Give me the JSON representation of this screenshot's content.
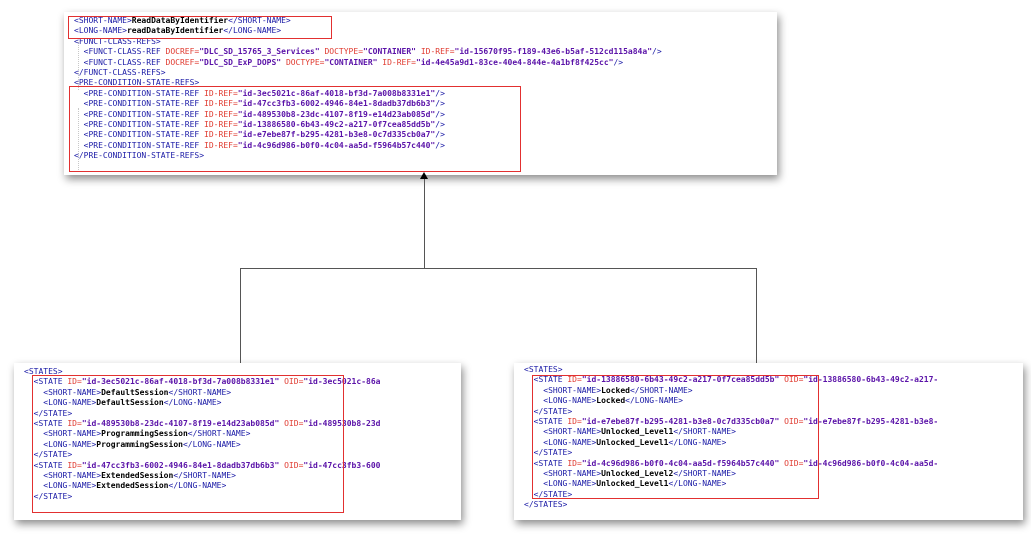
{
  "top_panel": {
    "lines": [
      [
        [
          "tag",
          "<SHORT-NAME>"
        ],
        [
          "txt",
          "ReadDataByIdentifier"
        ],
        [
          "tag",
          "</SHORT-NAME>"
        ]
      ],
      [
        [
          "tag",
          "<LONG-NAME>"
        ],
        [
          "txt",
          "readDataByIdentifier"
        ],
        [
          "tag",
          "</LONG-NAME>"
        ]
      ],
      [
        [
          "tag",
          "<FUNCT-CLASS-REFS>"
        ]
      ],
      [
        [
          "tag",
          "  <FUNCT-CLASS-REF "
        ],
        [
          "attr",
          "DOCREF="
        ],
        [
          "val",
          "\"DLC_SD_15765_3_Services\""
        ],
        [
          "attr",
          " DOCTYPE="
        ],
        [
          "val",
          "\"CONTAINER\""
        ],
        [
          "attr",
          " ID-REF="
        ],
        [
          "val",
          "\"id-15670f95-f189-43e6-b5af-512cd115a84a\""
        ],
        [
          "tag",
          "/>"
        ]
      ],
      [
        [
          "tag",
          "  <FUNCT-CLASS-REF "
        ],
        [
          "attr",
          "DOCREF="
        ],
        [
          "val",
          "\"DLC_SD_ExP_DOPS\""
        ],
        [
          "attr",
          " DOCTYPE="
        ],
        [
          "val",
          "\"CONTAINER\""
        ],
        [
          "attr",
          " ID-REF="
        ],
        [
          "val",
          "\"id-4e45a9d1-83ce-40e4-844e-4a1bf8f425cc\""
        ],
        [
          "tag",
          "/>"
        ]
      ],
      [
        [
          "tag",
          "</FUNCT-CLASS-REFS>"
        ]
      ],
      [
        [
          "tag",
          "<PRE-CONDITION-STATE-REFS>"
        ]
      ],
      [
        [
          "tag",
          "  <PRE-CONDITION-STATE-REF "
        ],
        [
          "attr",
          "ID-REF="
        ],
        [
          "val",
          "\"id-3ec5021c-86af-4018-bf3d-7a008b8331e1\""
        ],
        [
          "tag",
          "/>"
        ]
      ],
      [
        [
          "tag",
          "  <PRE-CONDITION-STATE-REF "
        ],
        [
          "attr",
          "ID-REF="
        ],
        [
          "val",
          "\"id-47cc3fb3-6002-4946-84e1-8dadb37db6b3\""
        ],
        [
          "tag",
          "/>"
        ]
      ],
      [
        [
          "tag",
          "  <PRE-CONDITION-STATE-REF "
        ],
        [
          "attr",
          "ID-REF="
        ],
        [
          "val",
          "\"id-489530b8-23dc-4107-8f19-e14d23ab085d\""
        ],
        [
          "tag",
          "/>"
        ]
      ],
      [
        [
          "tag",
          "  <PRE-CONDITION-STATE-REF "
        ],
        [
          "attr",
          "ID-REF="
        ],
        [
          "val",
          "\"id-13886580-6b43-49c2-a217-0f7cea85dd5b\""
        ],
        [
          "tag",
          "/>"
        ]
      ],
      [
        [
          "tag",
          "  <PRE-CONDITION-STATE-REF "
        ],
        [
          "attr",
          "ID-REF="
        ],
        [
          "val",
          "\"id-e7ebe87f-b295-4281-b3e8-0c7d335cb0a7\""
        ],
        [
          "tag",
          "/>"
        ]
      ],
      [
        [
          "tag",
          "  <PRE-CONDITION-STATE-REF "
        ],
        [
          "attr",
          "ID-REF="
        ],
        [
          "val",
          "\"id-4c96d986-b0f0-4c04-aa5d-f5964b57c440\""
        ],
        [
          "tag",
          "/>"
        ]
      ],
      [
        [
          "tag",
          "</PRE-CONDITION-STATE-REFS>"
        ]
      ]
    ]
  },
  "left_panel": {
    "lines": [
      [
        [
          "tag",
          "<STATES>"
        ]
      ],
      [
        [
          "tag",
          "  <STATE "
        ],
        [
          "attr",
          "ID="
        ],
        [
          "val",
          "\"id-3ec5021c-86af-4018-bf3d-7a008b8331e1\""
        ],
        [
          "attr",
          " OID="
        ],
        [
          "val",
          "\"id-3ec5021c-86a"
        ]
      ],
      [
        [
          "tag",
          "    <SHORT-NAME>"
        ],
        [
          "txt",
          "DefaultSession"
        ],
        [
          "tag",
          "</SHORT-NAME>"
        ]
      ],
      [
        [
          "tag",
          "    <LONG-NAME>"
        ],
        [
          "txt",
          "DefaultSession"
        ],
        [
          "tag",
          "</LONG-NAME>"
        ]
      ],
      [
        [
          "tag",
          "  </STATE>"
        ]
      ],
      [
        [
          "tag",
          "  <STATE "
        ],
        [
          "attr",
          "ID="
        ],
        [
          "val",
          "\"id-489530b8-23dc-4107-8f19-e14d23ab085d\""
        ],
        [
          "attr",
          " OID="
        ],
        [
          "val",
          "\"id-489530b8-23d"
        ]
      ],
      [
        [
          "tag",
          "    <SHORT-NAME>"
        ],
        [
          "txt",
          "ProgrammingSession"
        ],
        [
          "tag",
          "</SHORT-NAME>"
        ]
      ],
      [
        [
          "tag",
          "    <LONG-NAME>"
        ],
        [
          "txt",
          "ProgrammingSession"
        ],
        [
          "tag",
          "</LONG-NAME>"
        ]
      ],
      [
        [
          "tag",
          "  </STATE>"
        ]
      ],
      [
        [
          "tag",
          "  <STATE "
        ],
        [
          "attr",
          "ID="
        ],
        [
          "val",
          "\"id-47cc3fb3-6002-4946-84e1-8dadb37db6b3\""
        ],
        [
          "attr",
          " OID="
        ],
        [
          "val",
          "\"id-47cc3fb3-600"
        ]
      ],
      [
        [
          "tag",
          "    <SHORT-NAME>"
        ],
        [
          "txt",
          "ExtendedSession"
        ],
        [
          "tag",
          "</SHORT-NAME>"
        ]
      ],
      [
        [
          "tag",
          "    <LONG-NAME>"
        ],
        [
          "txt",
          "ExtendedSession"
        ],
        [
          "tag",
          "</LONG-NAME>"
        ]
      ],
      [
        [
          "tag",
          "  </STATE>"
        ]
      ]
    ]
  },
  "right_panel": {
    "lines": [
      [
        [
          "tag",
          "<STATES>"
        ]
      ],
      [
        [
          "tag",
          "  <STATE "
        ],
        [
          "attr",
          "ID="
        ],
        [
          "val",
          "\"id-13886580-6b43-49c2-a217-0f7cea85dd5b\""
        ],
        [
          "attr",
          " OID="
        ],
        [
          "val",
          "\"id-13886580-6b43-49c2-a217-"
        ]
      ],
      [
        [
          "tag",
          "    <SHORT-NAME>"
        ],
        [
          "txt",
          "Locked"
        ],
        [
          "tag",
          "</SHORT-NAME>"
        ]
      ],
      [
        [
          "tag",
          "    <LONG-NAME>"
        ],
        [
          "txt",
          "Locked"
        ],
        [
          "tag",
          "</LONG-NAME>"
        ]
      ],
      [
        [
          "tag",
          "  </STATE>"
        ]
      ],
      [
        [
          "tag",
          "  <STATE "
        ],
        [
          "attr",
          "ID="
        ],
        [
          "val",
          "\"id-e7ebe87f-b295-4281-b3e8-0c7d335cb0a7\""
        ],
        [
          "attr",
          " OID="
        ],
        [
          "val",
          "\"id-e7ebe87f-b295-4281-b3e8-"
        ]
      ],
      [
        [
          "tag",
          "    <SHORT-NAME>"
        ],
        [
          "txt",
          "Unlocked_Level1"
        ],
        [
          "tag",
          "</SHORT-NAME>"
        ]
      ],
      [
        [
          "tag",
          "    <LONG-NAME>"
        ],
        [
          "txt",
          "Unlocked_Level1"
        ],
        [
          "tag",
          "</LONG-NAME>"
        ]
      ],
      [
        [
          "tag",
          "  </STATE>"
        ]
      ],
      [
        [
          "tag",
          "  <STATE "
        ],
        [
          "attr",
          "ID="
        ],
        [
          "val",
          "\"id-4c96d986-b0f0-4c04-aa5d-f5964b57c440\""
        ],
        [
          "attr",
          " OID="
        ],
        [
          "val",
          "\"id-4c96d986-b0f0-4c04-aa5d-"
        ]
      ],
      [
        [
          "tag",
          "    <SHORT-NAME>"
        ],
        [
          "txt",
          "Unlocked_Level2"
        ],
        [
          "tag",
          "</SHORT-NAME>"
        ]
      ],
      [
        [
          "tag",
          "    <LONG-NAME>"
        ],
        [
          "txt",
          "Unlocked_Level1"
        ],
        [
          "tag",
          "</LONG-NAME>"
        ]
      ],
      [
        [
          "tag",
          "  </STATE>"
        ]
      ],
      [
        [
          "tag",
          "</STATES>"
        ]
      ]
    ]
  },
  "colors": {
    "tag": "#1a1aa6",
    "attribute": "#e03a2f",
    "value": "#5a12a8",
    "text": "#000000",
    "highlight": "#e23030"
  },
  "icons": [
    "arrowhead-up-icon"
  ]
}
